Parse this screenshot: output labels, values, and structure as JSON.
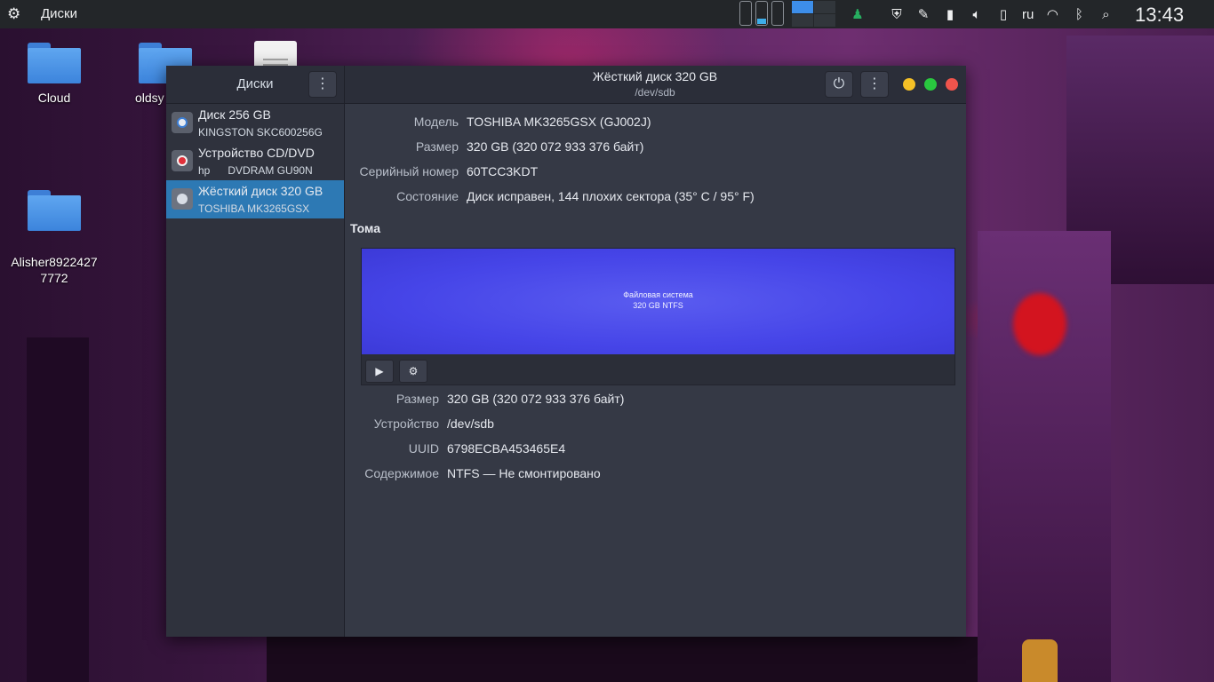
{
  "panel": {
    "app_title": "Диски",
    "lang": "ru",
    "clock": "13:43"
  },
  "desktop": {
    "icons": [
      {
        "label": "Cloud"
      },
      {
        "label": "oldsy"
      },
      {
        "label": "Alisher8922427\n7772"
      }
    ]
  },
  "window": {
    "sidebar_title": "Диски",
    "title": "Жёсткий диск 320 GB",
    "subtitle": "/dev/sdb",
    "drives": [
      {
        "name": "Диск 256 GB",
        "model": "KINGSTON SKC600256G",
        "icon": "disk-icon"
      },
      {
        "name": "Устройство CD/DVD",
        "model": "hp      DVDRAM GU90N",
        "icon": "optical-drive-icon"
      },
      {
        "name": "Жёсткий диск 320 GB",
        "model": "TOSHIBA MK3265GSX",
        "icon": "hard-disk-icon",
        "selected": true
      }
    ],
    "details": {
      "model_label": "Модель",
      "model_value": "TOSHIBA MK3265GSX (GJ002J)",
      "size_label": "Размер",
      "size_value": "320 GB (320 072 933 376 байт)",
      "serial_label": "Серийный номер",
      "serial_value": "60TCC3KDT",
      "state_label": "Состояние",
      "state_value": "Диск исправен, 144 плохих сектора (35° C / 95° F)"
    },
    "volumes_title": "Тома",
    "volume": {
      "line1": "Файловая система",
      "line2": "320 GB NTFS"
    },
    "volume_details": {
      "size_label": "Размер",
      "size_value": "320 GB (320 072 933 376 байт)",
      "device_label": "Устройство",
      "device_value": "/dev/sdb",
      "uuid_label": "UUID",
      "uuid_value": "6798ECBA453465E4",
      "content_label": "Содержимое",
      "content_value": "NTFS — Не смонтировано"
    }
  },
  "colors": {
    "selection": "#2d79b4",
    "volume_fill": "#4645e8",
    "close": "#f0544c",
    "minimize": "#f5c026",
    "maximize": "#29c73f"
  }
}
